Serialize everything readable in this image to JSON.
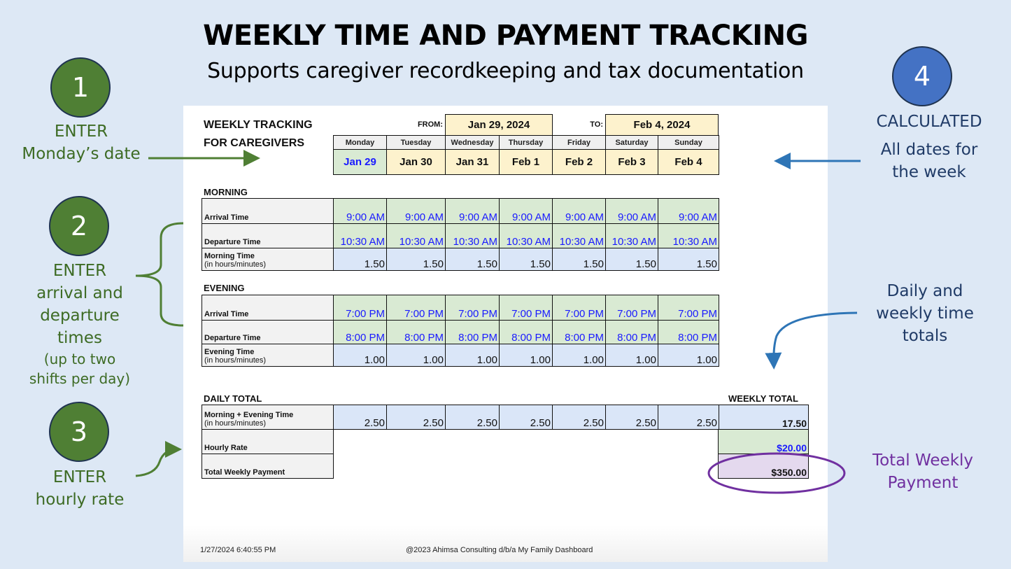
{
  "header": {
    "title": "WEEKLY TIME AND PAYMENT TRACKING",
    "subtitle": "Supports caregiver recordkeeping and tax documentation"
  },
  "callouts": [
    {
      "number": "1",
      "color": "#4f7f34",
      "line1": "ENTER",
      "line2": "Monday’s date"
    },
    {
      "number": "2",
      "color": "#4f7f34",
      "lines": [
        "ENTER",
        "arrival and",
        "departure",
        "times"
      ],
      "small_lines": [
        "(up to two",
        "shifts per day)"
      ]
    },
    {
      "number": "3",
      "color": "#4f7f34",
      "line1": "ENTER",
      "line2": "hourly rate"
    },
    {
      "number": "4",
      "color": "#4472c4",
      "line1": "CALCULATED",
      "lines": [
        "All dates for",
        "the week"
      ]
    }
  ],
  "notes": {
    "totals": [
      "Daily and",
      "weekly time",
      "totals"
    ],
    "payment": [
      "Total Weekly",
      "Payment"
    ]
  },
  "sheet": {
    "title_line1": "WEEKLY TRACKING",
    "title_line2": "FOR CAREGIVERS",
    "from_label": "FROM:",
    "from_value": "Jan 29, 2024",
    "to_label": "TO:",
    "to_value": "Feb 4, 2024",
    "days": [
      "Monday",
      "Tuesday",
      "Wednesday",
      "Thursday",
      "Friday",
      "Saturday",
      "Sunday"
    ],
    "dates": [
      "Jan 29",
      "Jan 30",
      "Jan 31",
      "Feb 1",
      "Feb 2",
      "Feb 3",
      "Feb 4"
    ],
    "morning": {
      "title": "MORNING",
      "arrival_label": "Arrival Time",
      "departure_label": "Departure Time",
      "time_label": "Morning Time",
      "time_sublabel": "(in hours/minutes)",
      "arrival": [
        "9:00 AM",
        "9:00 AM",
        "9:00 AM",
        "9:00 AM",
        "9:00 AM",
        "9:00 AM",
        "9:00 AM"
      ],
      "departure": [
        "10:30 AM",
        "10:30 AM",
        "10:30 AM",
        "10:30 AM",
        "10:30 AM",
        "10:30 AM",
        "10:30 AM"
      ],
      "hours": [
        "1.50",
        "1.50",
        "1.50",
        "1.50",
        "1.50",
        "1.50",
        "1.50"
      ]
    },
    "evening": {
      "title": "EVENING",
      "arrival_label": "Arrival Time",
      "departure_label": "Departure Time",
      "time_label": "Evening Time",
      "time_sublabel": "(in hours/minutes)",
      "arrival": [
        "7:00 PM",
        "7:00 PM",
        "7:00 PM",
        "7:00 PM",
        "7:00 PM",
        "7:00 PM",
        "7:00 PM"
      ],
      "departure": [
        "8:00 PM",
        "8:00 PM",
        "8:00 PM",
        "8:00 PM",
        "8:00 PM",
        "8:00 PM",
        "8:00 PM"
      ],
      "hours": [
        "1.00",
        "1.00",
        "1.00",
        "1.00",
        "1.00",
        "1.00",
        "1.00"
      ]
    },
    "daily_total": {
      "title": "DAILY TOTAL",
      "combined_label": "Morning + Evening Time",
      "combined_sublabel": "(in hours/minutes)",
      "combined": [
        "2.50",
        "2.50",
        "2.50",
        "2.50",
        "2.50",
        "2.50",
        "2.50"
      ],
      "rate_label": "Hourly Rate",
      "payment_label": "Total Weekly Payment"
    },
    "weekly_total": {
      "title": "WEEKLY TOTAL",
      "hours": "17.50",
      "rate": "$20.00",
      "payment": "$350.00"
    },
    "footer": {
      "timestamp": "1/27/2024 6:40:55 PM",
      "copyright": "@2023 Ahimsa Consulting d/b/a My Family Dashboard"
    }
  }
}
